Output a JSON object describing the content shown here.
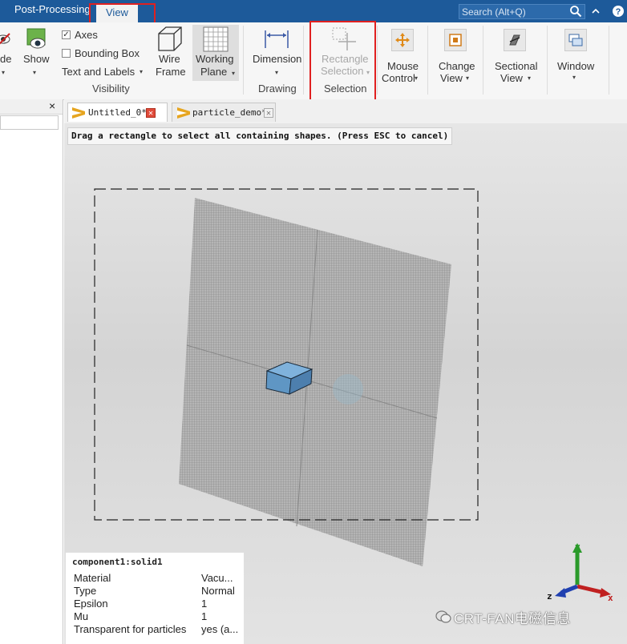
{
  "titlebar": {
    "tabs": [
      {
        "label": "Post-Processing",
        "active": false
      },
      {
        "label": "View",
        "active": true
      }
    ],
    "search_placeholder": "Search (Alt+Q)",
    "help_icon": "help-icon",
    "collapse_icon": "chevron-up-icon",
    "accent": "#1d5a9a"
  },
  "ribbon": {
    "hide_label": "de",
    "show_label": "Show",
    "axes_label": "Axes",
    "axes_checked": true,
    "bbox_label": "Bounding Box",
    "bbox_checked": false,
    "text_labels_label": "Text and Labels",
    "visibility_group": "Visibility",
    "wire_frame_l1": "Wire",
    "wire_frame_l2": "Frame",
    "working_plane_l1": "Working",
    "working_plane_l2": "Plane",
    "dimension_label": "Dimension",
    "drawing_group": "Drawing",
    "rect_sel_l1": "Rectangle",
    "rect_sel_l2": "Selection",
    "selection_group": "Selection",
    "mouse_l1": "Mouse",
    "mouse_l2": "Control",
    "change_view_l1": "Change",
    "change_view_l2": "View",
    "sectional_l1": "Sectional",
    "sectional_l2": "View",
    "window_label": "Window",
    "highlight_color": "#e02020"
  },
  "panel": {
    "close_label": "×"
  },
  "tabs": [
    {
      "label": "Untitled_0*",
      "active": true
    },
    {
      "label": "particle_demo*",
      "active": false
    }
  ],
  "viewport": {
    "hint": "Drag a rectangle to select all containing shapes. (Press ESC to cancel)"
  },
  "properties": {
    "header": "component1:solid1",
    "rows": [
      {
        "key": "Material",
        "value": "Vacu..."
      },
      {
        "key": "Type",
        "value": "Normal"
      },
      {
        "key": "Epsilon",
        "value": "1"
      },
      {
        "key": "Mu",
        "value": "1"
      },
      {
        "key": "Transparent for particles",
        "value": "yes (a..."
      }
    ]
  },
  "axes": {
    "x": "x",
    "y": "y",
    "z": "z"
  },
  "watermark": "CRT-FAN电磁信息"
}
